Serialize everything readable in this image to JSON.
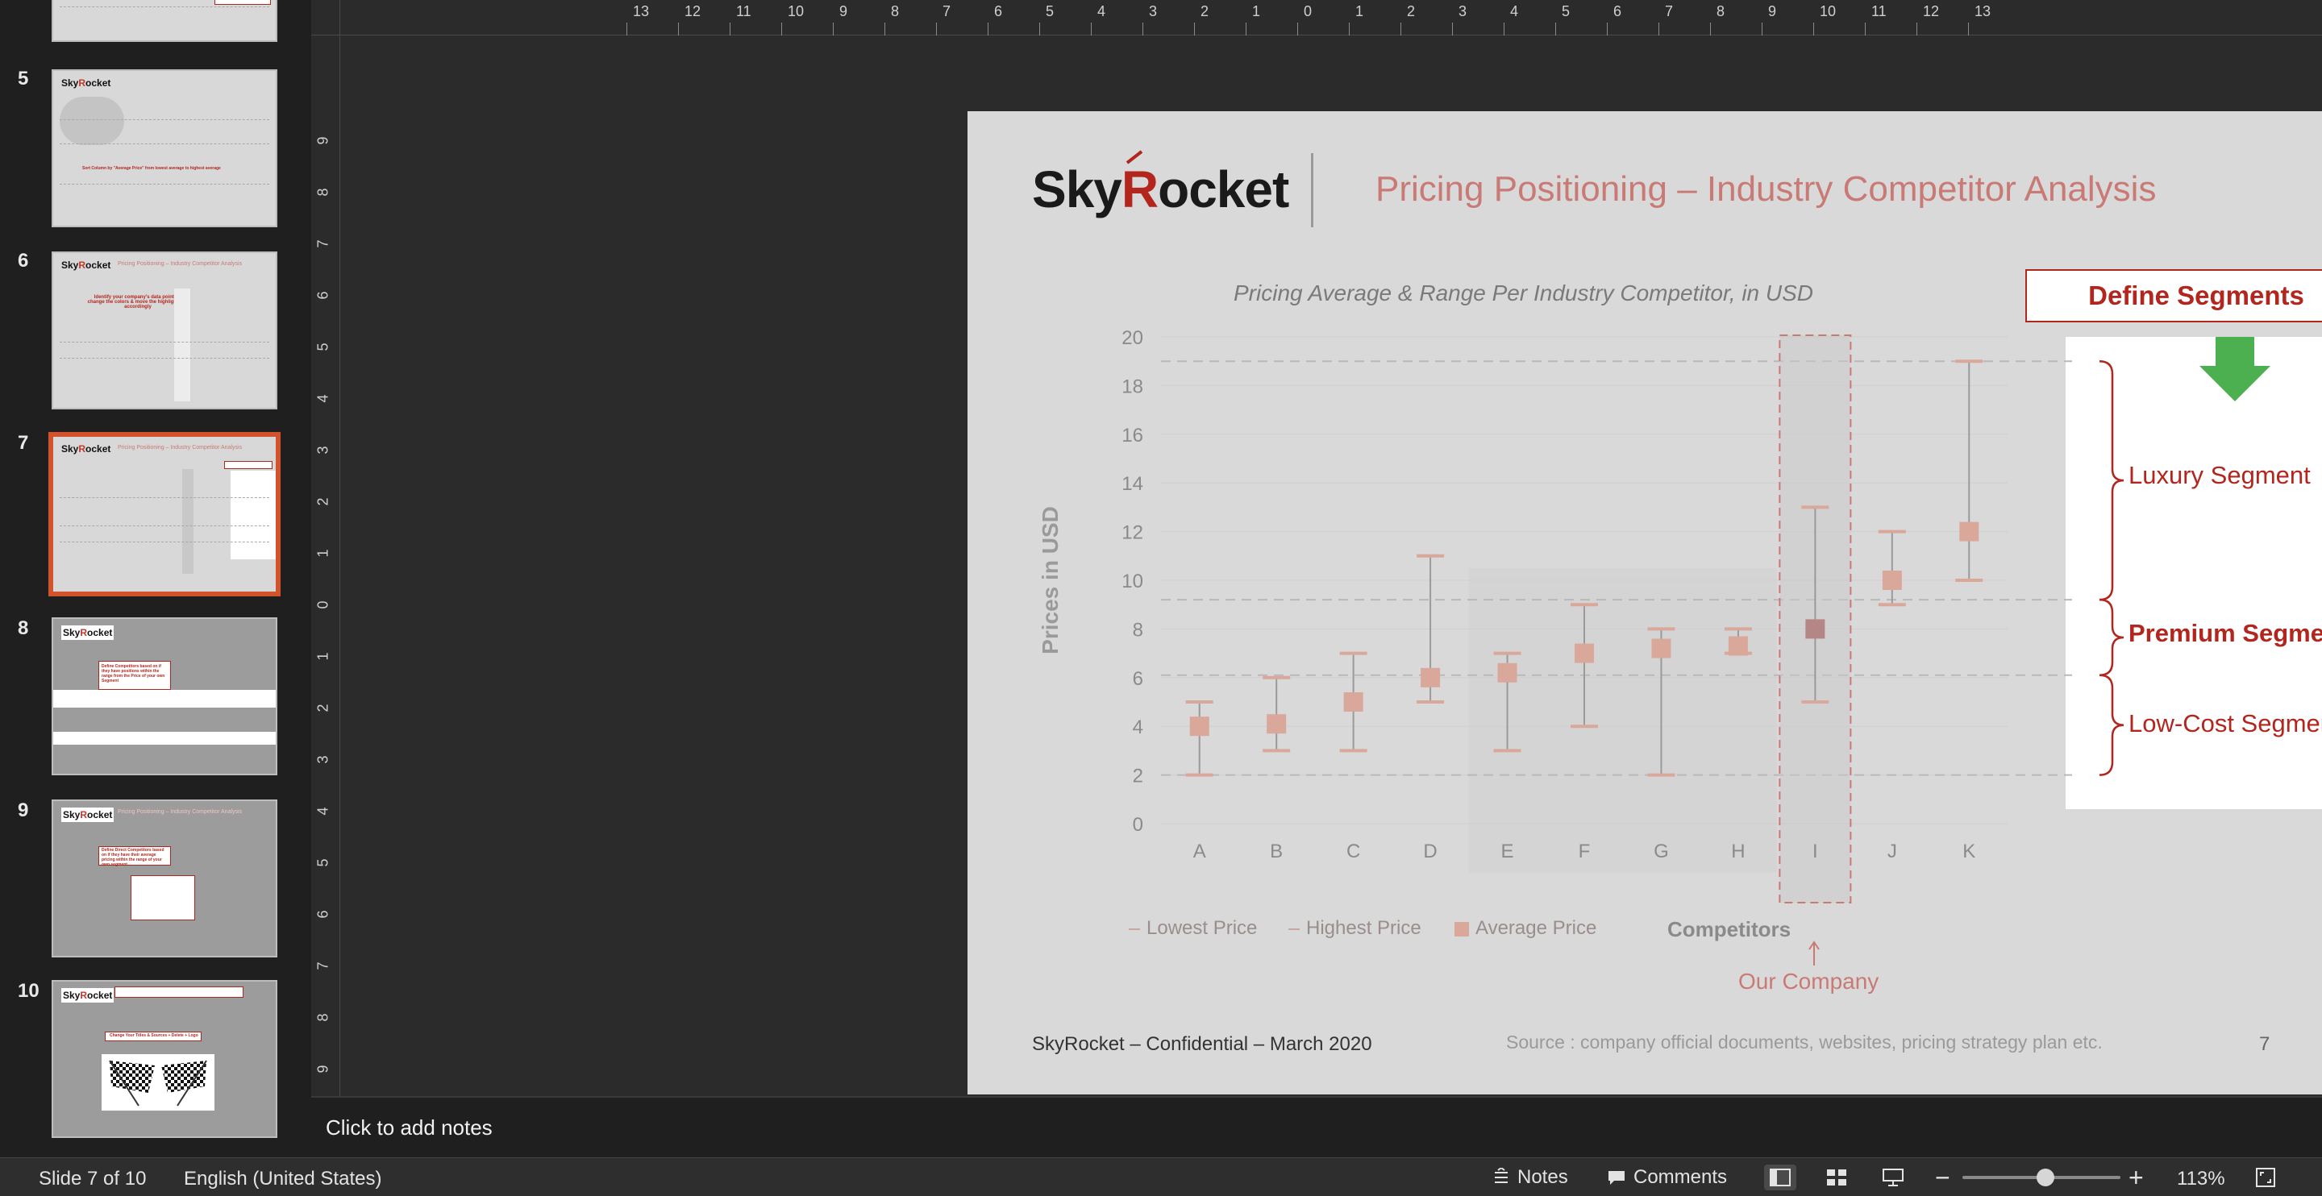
{
  "sidebar": {
    "slides": [
      {
        "number": "",
        "kind": "partial"
      },
      {
        "number": "5",
        "kind": "sorted",
        "note": "Sort Column by \"Average Price\" from lowest average to highest average"
      },
      {
        "number": "6",
        "kind": "identify",
        "note": "Identify your company's data points & change the colors & move the highlight box accordingly"
      },
      {
        "number": "7",
        "kind": "segments",
        "selected": true
      },
      {
        "number": "8",
        "kind": "competitors",
        "note": "Define Competitors based on if they have positions within the range from the Price of your own Segment"
      },
      {
        "number": "9",
        "kind": "direct",
        "note": "Define Direct Competitors based on if they have their average pricing within the range of your own segment"
      },
      {
        "number": "10",
        "kind": "flags",
        "note": "Change Your Titles & Sources + Delete + Logo"
      }
    ]
  },
  "ruler": {
    "horizontal_labels": [
      "13",
      "12",
      "11",
      "10",
      "9",
      "8",
      "7",
      "6",
      "5",
      "4",
      "3",
      "2",
      "1",
      "0",
      "1",
      "2",
      "3",
      "4",
      "5",
      "6",
      "7",
      "8",
      "9",
      "10",
      "11",
      "12",
      "13"
    ],
    "vertical_labels": [
      "9",
      "8",
      "7",
      "6",
      "5",
      "4",
      "3",
      "2",
      "1",
      "0",
      "1",
      "2",
      "3",
      "4",
      "5",
      "6",
      "7",
      "8",
      "9"
    ]
  },
  "slide": {
    "logo_prefix": "Sky",
    "logo_r": "R",
    "logo_suffix": "ocket",
    "title": "Pricing Positioning – Industry Competitor Analysis",
    "chart_title": "Pricing Average & Range Per Industry Competitor, in USD",
    "define_segments": "Define Segments",
    "segments": {
      "luxury": "Luxury Segment",
      "premium": "Premium Segment",
      "lowcost": "Low-Cost Segment"
    },
    "legend": {
      "lowest": "Lowest Price",
      "highest": "Highest Price",
      "average": "Average Price"
    },
    "competitors_label": "Competitors",
    "our_company": "Our Company",
    "footer_left": "SkyRocket – Confidential – March 2020",
    "footer_source": "Source : company official documents, websites, pricing strategy plan etc.",
    "page_number": "7",
    "colors": {
      "accent_red": "#b3261e",
      "muted_red": "#c97a75",
      "marker": "#d9a89a",
      "highlight_marker": "#b58686",
      "green_arrow": "#4caf50"
    }
  },
  "chart_data": {
    "type": "scatter",
    "title": "Pricing Average & Range Per Industry Competitor, in USD",
    "xlabel": "Competitors",
    "ylabel": "Prices in USD",
    "ylim": [
      0,
      20
    ],
    "yticks": [
      0,
      2,
      4,
      6,
      8,
      10,
      12,
      14,
      16,
      18,
      20
    ],
    "categories": [
      "A",
      "B",
      "C",
      "D",
      "E",
      "F",
      "G",
      "H",
      "I",
      "J",
      "K"
    ],
    "series": [
      {
        "name": "Lowest Price",
        "values": [
          2,
          3,
          3,
          5,
          3,
          4,
          2,
          7,
          5,
          9,
          10
        ]
      },
      {
        "name": "Highest Price",
        "values": [
          5,
          6,
          7,
          11,
          7,
          9,
          8,
          8,
          13,
          12,
          19
        ]
      },
      {
        "name": "Average Price",
        "values": [
          4,
          4.1,
          5,
          6,
          6.2,
          7,
          7.2,
          7.3,
          8,
          10,
          12
        ]
      }
    ],
    "highlight_category": "I",
    "segment_bounds": [
      2,
      6.1,
      9.2,
      19
    ]
  },
  "notes": {
    "placeholder": "Click to add notes"
  },
  "status": {
    "slide_counter": "Slide 7 of 10",
    "language": "English (United States)",
    "notes_btn": "Notes",
    "comments_btn": "Comments",
    "zoom": "113%"
  }
}
